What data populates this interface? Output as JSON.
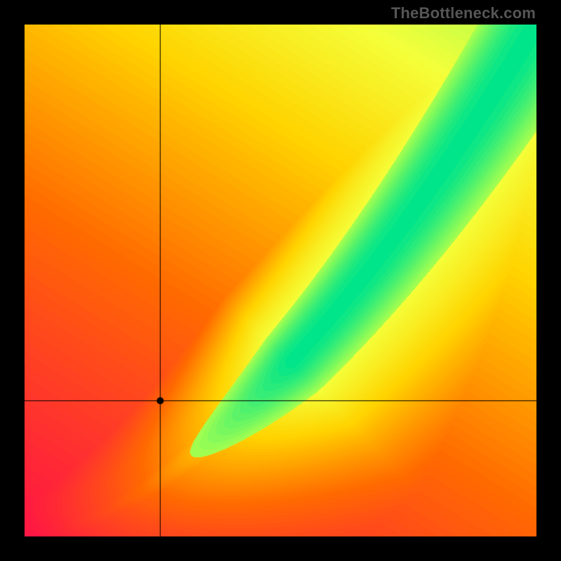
{
  "watermark": "TheBottleneck.com",
  "chart_data": {
    "type": "heatmap",
    "title": "",
    "xlabel": "",
    "ylabel": "",
    "xlim": [
      0,
      1
    ],
    "ylim": [
      0,
      1
    ],
    "grid": false,
    "legend": false,
    "ridge_exponent": 1.65,
    "ridge_half_width": 0.045,
    "background_warmth_bias": 0.55,
    "crosshair": {
      "x": 0.265,
      "y": 0.265
    },
    "marker": {
      "x": 0.265,
      "y": 0.265,
      "radius_px": 5
    },
    "color_stops": [
      {
        "t": 0.0,
        "color": "#ff1744"
      },
      {
        "t": 0.3,
        "color": "#ff6a00"
      },
      {
        "t": 0.55,
        "color": "#ffd400"
      },
      {
        "t": 0.72,
        "color": "#f4ff3a"
      },
      {
        "t": 0.86,
        "color": "#a8ff4d"
      },
      {
        "t": 1.0,
        "color": "#00e58a"
      }
    ]
  }
}
